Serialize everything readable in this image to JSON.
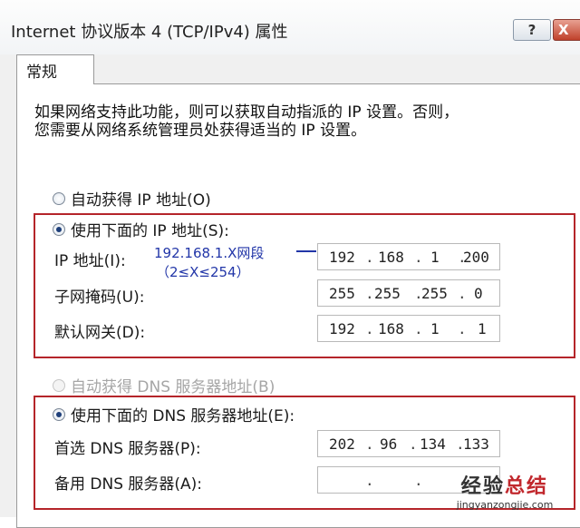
{
  "window": {
    "title": "Internet 协议版本 4 (TCP/IPv4) 属性",
    "help_label": "?",
    "close_label": "X"
  },
  "tab": {
    "label": "常规"
  },
  "description": {
    "line1": "如果网络支持此功能，则可以获取自动指派的 IP 设置。否则，",
    "line2": "您需要从网络系统管理员处获得适当的 IP 设置。"
  },
  "ip_section": {
    "auto_label": "自动获得 IP 地址(O)",
    "manual_label": "使用下面的 IP 地址(S):",
    "ip_label": "IP 地址(I):",
    "subnet_label": "子网掩码(U):",
    "gateway_label": "默认网关(D):",
    "ip_value": [
      "192",
      "168",
      "1",
      "200"
    ],
    "subnet_value": [
      "255",
      "255",
      "255",
      "0"
    ],
    "gateway_value": [
      "192",
      "168",
      "1",
      "1"
    ],
    "annotation_line1": "192.168.1.X网段",
    "annotation_line2": "（2≤X≤254）"
  },
  "dns_section": {
    "auto_label": "自动获得 DNS 服务器地址(B)",
    "manual_label": "使用下面的 DNS 服务器地址(E):",
    "preferred_label": "首选 DNS 服务器(P):",
    "alternate_label": "备用 DNS 服务器(A):",
    "preferred_value": [
      "202",
      "96",
      "134",
      "133"
    ],
    "alternate_value": [
      "",
      "",
      "",
      ""
    ]
  },
  "watermark": {
    "text_black": "经验",
    "text_red": "总结",
    "url": "jingyanzongjie.com"
  },
  "colors": {
    "highlight_border": "#b5252a",
    "annotation": "#2236a8",
    "titlebar": "#f2f4f6"
  }
}
